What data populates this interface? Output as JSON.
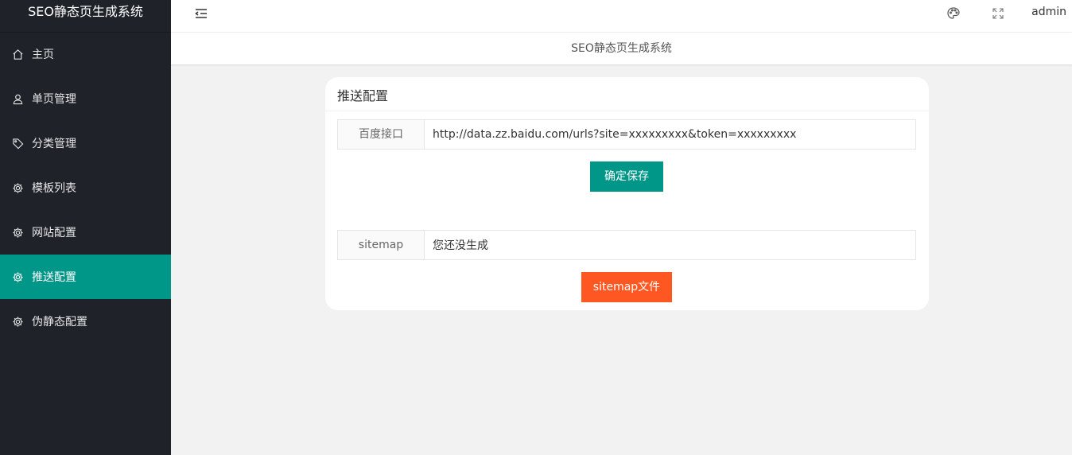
{
  "app": {
    "title": "SEO静态页生成系统"
  },
  "sidebar": {
    "items": [
      {
        "label": "主页",
        "icon": "home-icon"
      },
      {
        "label": "单页管理",
        "icon": "user-icon"
      },
      {
        "label": "分类管理",
        "icon": "tag-icon"
      },
      {
        "label": "模板列表",
        "icon": "gear-icon"
      },
      {
        "label": "网站配置",
        "icon": "gear-icon"
      },
      {
        "label": "推送配置",
        "icon": "gear-icon",
        "active": true
      },
      {
        "label": "伪静态配置",
        "icon": "gear-icon"
      }
    ]
  },
  "header": {
    "user": "admin"
  },
  "tabbar": {
    "title": "SEO静态页生成系统"
  },
  "card": {
    "title": "推送配置",
    "baidu": {
      "label": "百度接口",
      "value": "http://data.zz.baidu.com/urls?site=xxxxxxxxx&token=xxxxxxxxx"
    },
    "save_button": "确定保存",
    "sitemap": {
      "label": "sitemap",
      "value": "您还没生成"
    },
    "sitemap_button": "sitemap文件"
  },
  "colors": {
    "accent": "#009688",
    "warn": "#ff5722",
    "sidebar_bg": "#20222a"
  }
}
